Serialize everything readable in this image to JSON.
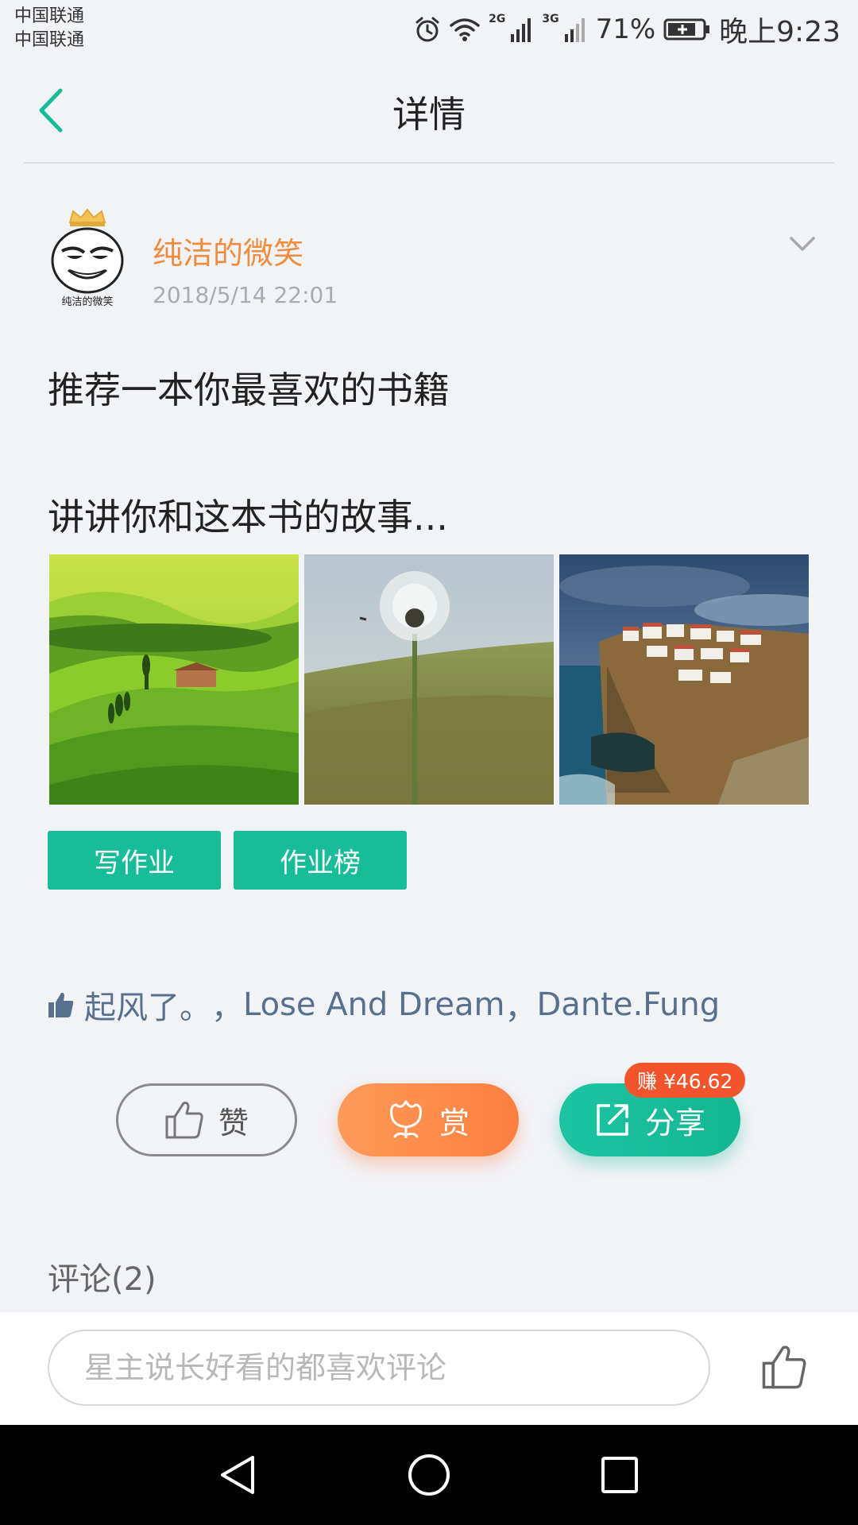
{
  "status_bar": {
    "carrier_1": "中国联通",
    "carrier_2": "中国联通",
    "network_1": "2G",
    "network_2": "3G",
    "battery_percent": "71%",
    "time": "晚上9:23",
    "icons": [
      "alarm-icon",
      "wifi-icon",
      "signal-icon",
      "signal-icon",
      "battery-charging-icon"
    ]
  },
  "header": {
    "title": "详情",
    "back_icon": "chevron-left-icon"
  },
  "post": {
    "author_name": "纯洁的微笑",
    "author_avatar_caption": "纯洁的微笑",
    "time": "2018/5/14 22:01",
    "line_1": "推荐一本你最喜欢的书籍",
    "line_2": "讲讲你和这本书的故事...",
    "images": [
      "green-hills-photo",
      "dandelion-photo",
      "cliff-town-photo"
    ]
  },
  "tags": {
    "write_homework": "写作业",
    "homework_ranking": "作业榜"
  },
  "likers": {
    "names": [
      "起风了。",
      "Lose And Dream",
      "Dante.Fung"
    ],
    "separator": "，"
  },
  "actions": {
    "like_label": "赞",
    "reward_label": "赏",
    "share_label": "分享",
    "earn_badge": "赚 ¥46.62"
  },
  "comments": {
    "heading": "评论(2)",
    "input_placeholder": "星主说长好看的都喜欢评论"
  },
  "colors": {
    "accent_green": "#19bc98",
    "author_orange": "#f08c3e",
    "reward_orange": "#fb7f3e",
    "badge_red": "#f2552c",
    "liker_blue": "#56708e"
  }
}
